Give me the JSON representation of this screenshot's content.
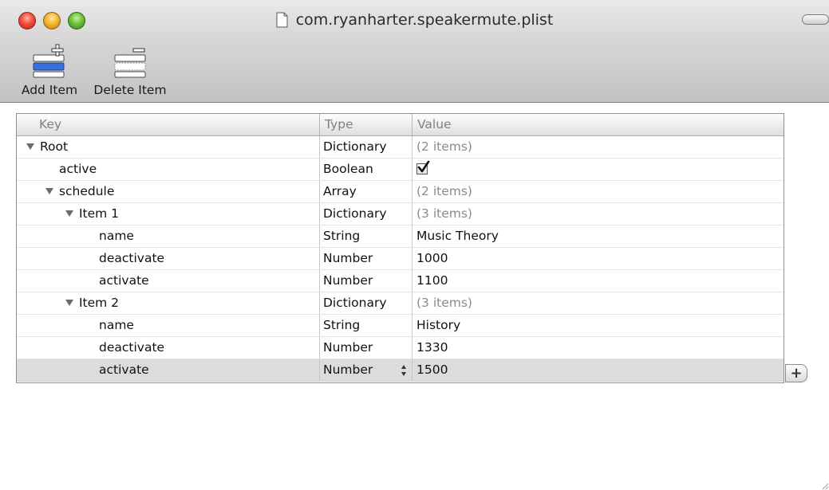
{
  "window": {
    "title": "com.ryanharter.speakermute.plist"
  },
  "toolbar": {
    "add_label": "Add Item",
    "delete_label": "Delete Item"
  },
  "table": {
    "headers": {
      "key": "Key",
      "type": "Type",
      "value": "Value"
    },
    "rows": [
      {
        "key": "Root",
        "type": "Dictionary",
        "value": "(2 items)",
        "depth": 0,
        "expandable": true
      },
      {
        "key": "active",
        "type": "Boolean",
        "value": "",
        "depth": 1,
        "checked": true
      },
      {
        "key": "schedule",
        "type": "Array",
        "value": "(2 items)",
        "depth": 1,
        "expandable": true
      },
      {
        "key": "Item 1",
        "type": "Dictionary",
        "value": "(3 items)",
        "depth": 2,
        "expandable": true
      },
      {
        "key": "name",
        "type": "String",
        "value": "Music Theory",
        "depth": 3
      },
      {
        "key": "deactivate",
        "type": "Number",
        "value": "1000",
        "depth": 3
      },
      {
        "key": "activate",
        "type": "Number",
        "value": "1100",
        "depth": 3
      },
      {
        "key": "Item 2",
        "type": "Dictionary",
        "value": "(3 items)",
        "depth": 2,
        "expandable": true
      },
      {
        "key": "name",
        "type": "String",
        "value": "History",
        "depth": 3
      },
      {
        "key": "deactivate",
        "type": "Number",
        "value": "1330",
        "depth": 3
      },
      {
        "key": "activate",
        "type": "Number",
        "value": "1500",
        "depth": 3,
        "selected": true
      }
    ],
    "add_row_symbol": "+"
  },
  "colors": {
    "close": "#f24c3d",
    "minimize": "#f6b52f",
    "zoom": "#6ac13a",
    "selection": "#dcdcdc",
    "muted_text": "#8a8a8a"
  },
  "icons": {
    "add_item": "add-item-icon",
    "delete_item": "delete-item-icon",
    "document": "document-icon",
    "checkbox": "checkmark-icon",
    "stepper": "stepper-icon"
  }
}
